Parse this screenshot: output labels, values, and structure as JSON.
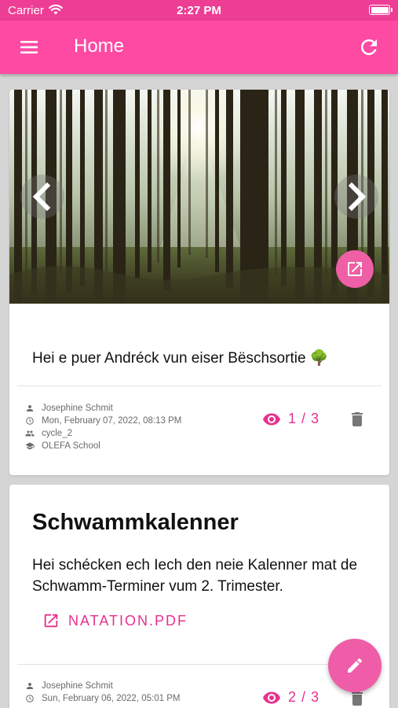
{
  "status_bar": {
    "carrier": "Carrier",
    "time": "2:27 PM"
  },
  "app_bar": {
    "title": "Home",
    "menu_icon": "menu-icon",
    "refresh_icon": "refresh-icon"
  },
  "colors": {
    "primary": "#fe4aa3",
    "status_bar": "#ed3d94",
    "accent": "#e8308e",
    "background": "#d5d5d5"
  },
  "posts": [
    {
      "text": "Hei e puer Andréck vun eiser Bëschsortie 🌳",
      "author": "Josephine Schmit",
      "date": "Mon, February 07, 2022, 08:13 PM",
      "group": "cycle_2",
      "school": "OLEFA School",
      "views": "1 / 3"
    },
    {
      "title": "Schwammkalenner",
      "text": "Hei schécken ech Iech den neie Kalenner mat de Schwamm-Terminer vum 2. Trimester.",
      "attachment": "NATATION.PDF",
      "author": "Josephine Schmit",
      "date": "Sun, February 06, 2022, 05:01 PM",
      "views": "2 / 3"
    }
  ]
}
